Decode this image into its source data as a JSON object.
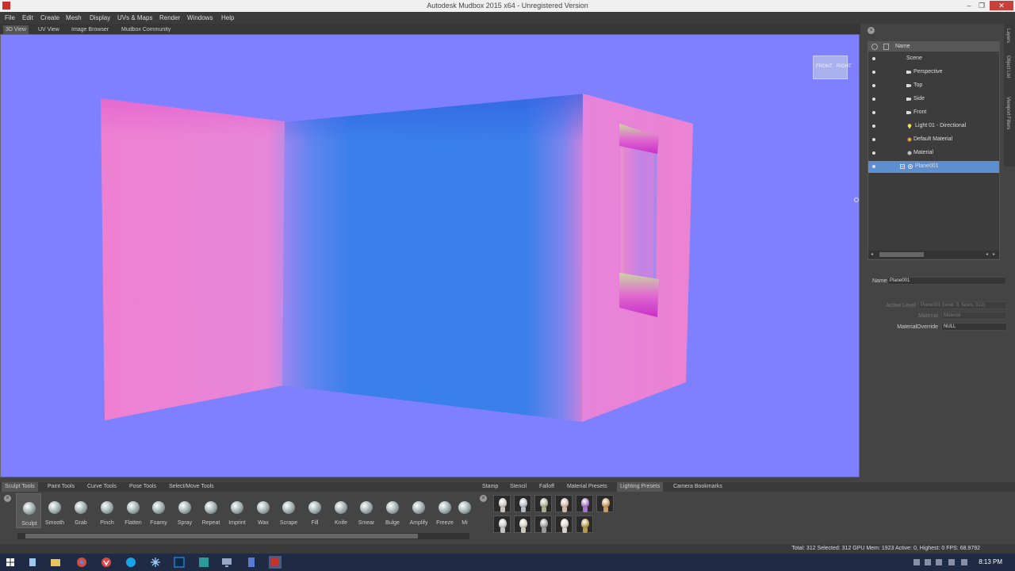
{
  "window": {
    "title": "Autodesk Mudbox 2015 x64 - Unregistered Version",
    "minimize": "–",
    "maximize": "❐",
    "close": "✕"
  },
  "menu": [
    "File",
    "Edit",
    "Create",
    "Mesh",
    "Display",
    "UVs & Maps",
    "Render",
    "Windows",
    "Help"
  ],
  "view_tabs": [
    "3D View",
    "UV View",
    "Image Browser",
    "Mudbox Community"
  ],
  "active_view_tab": "3D View",
  "viewcube": {
    "front": "FRONT",
    "right": "RIGHT"
  },
  "side_tabs": [
    "Layers",
    "Object List",
    "Viewport Filters"
  ],
  "object_list": {
    "header": "Name",
    "items": [
      {
        "label": "Scene",
        "icon": "none"
      },
      {
        "label": "Perspective",
        "icon": "camera-icon"
      },
      {
        "label": "Top",
        "icon": "camera-icon"
      },
      {
        "label": "Side",
        "icon": "camera-icon"
      },
      {
        "label": "Front",
        "icon": "camera-icon"
      },
      {
        "label": "Light 01 - Directional",
        "icon": "light-icon"
      },
      {
        "label": "Default Material",
        "icon": "material-icon"
      },
      {
        "label": "Material",
        "icon": "material-icon"
      },
      {
        "label": "Plane001",
        "icon": "mesh-icon",
        "selected": true
      }
    ]
  },
  "properties": {
    "name_label": "Name",
    "name_value": "Plane001",
    "active_level_label": "Active Level",
    "active_level_value": "Plane001 (level: 0, faces: 312)",
    "material_label": "Material",
    "material_value": "Material",
    "override_label": "MaterialOverride",
    "override_value": "NULL"
  },
  "bottom_tabs": [
    "Sculpt Tools",
    "Paint Tools",
    "Curve Tools",
    "Pose Tools",
    "Select/Move Tools"
  ],
  "active_bottom_tab": "Sculpt Tools",
  "right_tabs": [
    "Stamp",
    "Stencil",
    "Falloff",
    "Material Presets",
    "Lighting Presets",
    "Camera Bookmarks"
  ],
  "active_right_tab": "Lighting Presets",
  "tools": [
    "Sculpt",
    "Smooth",
    "Grab",
    "Pinch",
    "Flatten",
    "Foamy",
    "Spray",
    "Repeat",
    "Imprint",
    "Wax",
    "Scrape",
    "Fill",
    "Knife",
    "Smear",
    "Bulge",
    "Amplify",
    "Freeze",
    "Mi"
  ],
  "active_tool": "Sculpt",
  "lighting_presets": {
    "count": 11,
    "colors": [
      "#c9c4c0",
      "#b7bcc4",
      "#a8b090",
      "#d2b8a6",
      "#a775c8",
      "#c89a62",
      "#c3c3c3",
      "#d0c8bc",
      "#9a9a9a",
      "#d6d0cc",
      "#b49a50"
    ]
  },
  "status": "Total: 312  Selected: 312  GPU Mem: 1923  Active: 0, Highest: 0  FPS: 68.9792",
  "taskbar": {
    "clock": "8:13 PM"
  },
  "colors": {
    "viewport_bg": "#7f80ff",
    "wall_pink": "#ea7fd6",
    "wall_blue": "#3a7fea",
    "selection": "#5d8fd0"
  }
}
